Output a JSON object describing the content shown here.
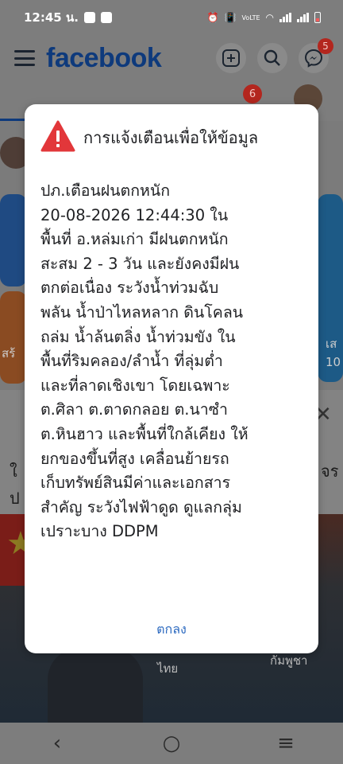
{
  "status_bar": {
    "time": "12:45 น.",
    "network": "VoLTE"
  },
  "header": {
    "logo": "facebook",
    "messenger_badge": "5"
  },
  "tabs": {
    "notifications_badge": "6"
  },
  "background": {
    "side_text_left": "สร้",
    "side_text_right_1": "เส",
    "side_text_right_2": "10",
    "post_line_left_1": "ใ",
    "post_line_left_2": "ป",
    "post_line_right": "จร",
    "video_label_1": "ไทย",
    "video_label_2": "กัมพูชา"
  },
  "dialog": {
    "title": "การแจ้งเตือนเพื่อให้ข้อมูล",
    "body_lines": [
      "ปภ.เตือนฝนตกหนัก",
      "20-08-2026 12:44:30 ใน",
      "พื้นที่ อ.หล่มเก่า มีฝนตกหนัก",
      "สะสม 2 - 3 วัน และยังคงมีฝน",
      "ตกต่อเนื่อง ระวังน้ำท่วมฉับ",
      "พลัน น้ำป่าไหลหลาก ดินโคลน",
      "ถล่ม น้ำล้นตลิ่ง น้ำท่วมขัง ใน",
      "พื้นที่ริมคลอง/ลำน้ำ ที่ลุ่มต่ำ",
      "และที่ลาดเชิงเขา โดยเฉพาะ",
      "ต.ศิลา ต.ตาดกลอย ต.นาซำ",
      "ต.หินฮาว และพื้นที่ใกล้เคียง ให้",
      "ยกของขึ้นที่สูง เคลื่อนย้ายรถ",
      "เก็บทรัพย์สินมีค่าและเอกสาร",
      "สำคัญ ระวังไฟฟ้าดูด ดูแลกลุ่ม",
      "เปราะบาง DDPM"
    ],
    "ok_label": "ตกลง"
  },
  "colors": {
    "warning": "#e2373a",
    "link": "#2e6bc0",
    "facebook_blue": "#0e3a7c"
  }
}
